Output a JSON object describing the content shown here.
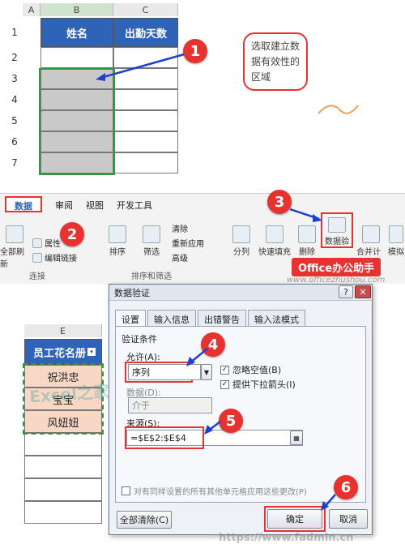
{
  "sheet1": {
    "col_a": "A",
    "col_b": "B",
    "col_c": "C",
    "header_name": "姓名",
    "header_days": "出勤天数",
    "row_numbers": [
      "1",
      "2",
      "3",
      "4",
      "5",
      "6",
      "7"
    ]
  },
  "callout1": {
    "text": "选取建立数据有效性的区域"
  },
  "markers": {
    "m1": "1",
    "m2": "2",
    "m3": "3",
    "m4": "4",
    "m5": "5",
    "m6": "6"
  },
  "ribbon": {
    "tabs": [
      "数据",
      "审阅",
      "视图",
      "开发工具"
    ],
    "refresh_label": "全部刷新",
    "props_label": "属性",
    "edit_links_label": "编辑链接",
    "connections_group": "连接",
    "sort_label": "排序",
    "filter_label": "筛选",
    "clear_label": "清除",
    "reapply_label": "重新应用",
    "advanced_label": "高级",
    "sort_filter_group": "排序和筛选",
    "split_label": "分列",
    "flashfill_label": "快速填充",
    "remove_dup_label": "删除",
    "validation_label": "数据验",
    "consolidate_label": "合并计算",
    "whatif_label": "模拟"
  },
  "brand": {
    "badge": "Office办公助手",
    "url": "www.officezhushou.com"
  },
  "sheet2": {
    "col_e": "E",
    "header": "员工花名册",
    "names": [
      "祝洪忠",
      "宝宝",
      "风妞妞"
    ],
    "watermark": "Excel之家"
  },
  "dialog": {
    "title": "数据验证",
    "tabs": [
      "设置",
      "输入信息",
      "出错警告",
      "输入法模式"
    ],
    "criteria_label": "验证条件",
    "allow_label": "允许(A):",
    "allow_value": "序列",
    "ignore_blank": "忽略空值(B)",
    "dropdown": "提供下拉箭头(I)",
    "data_label": "数据(D):",
    "data_value": "介于",
    "source_label": "来源(S):",
    "source_value": "=$E$2:$E$4",
    "apply_all": "对有同样设置的所有其他单元格应用这些更改(P)",
    "clear_all": "全部清除(C)",
    "ok": "确定",
    "cancel": "取消",
    "help": "?",
    "close": "✕"
  },
  "footer_watermark": "https://www.fadmin.cn",
  "colors": {
    "accent_red": "#e8322f",
    "header_blue": "#2e63b8",
    "arrow_blue": "#1f3fd1"
  }
}
